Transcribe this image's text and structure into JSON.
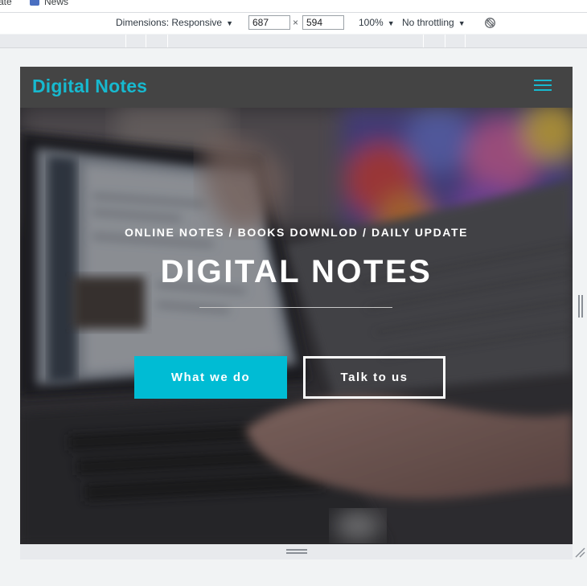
{
  "bookmarks": {
    "left_fragment": "ate",
    "item": "News"
  },
  "device_toolbar": {
    "dimensions_label": "Dimensions: Responsive",
    "width": "687",
    "height": "594",
    "separator": "×",
    "zoom": "100%",
    "throttling": "No throttling",
    "rotate_icon": "rotate-icon"
  },
  "site": {
    "brand": "Digital Notes",
    "menu_icon": "hamburger-menu-icon",
    "hero": {
      "kicker": "ONLINE NOTES / BOOKS DOWNLOD / DAILY UPDATE",
      "title": "DIGITAL NOTES",
      "primary_button": "What we do",
      "secondary_button": "Talk to us"
    }
  },
  "colors": {
    "accent": "#00bcd4",
    "navbar": "#444444",
    "brand_text": "#17b9cf"
  }
}
